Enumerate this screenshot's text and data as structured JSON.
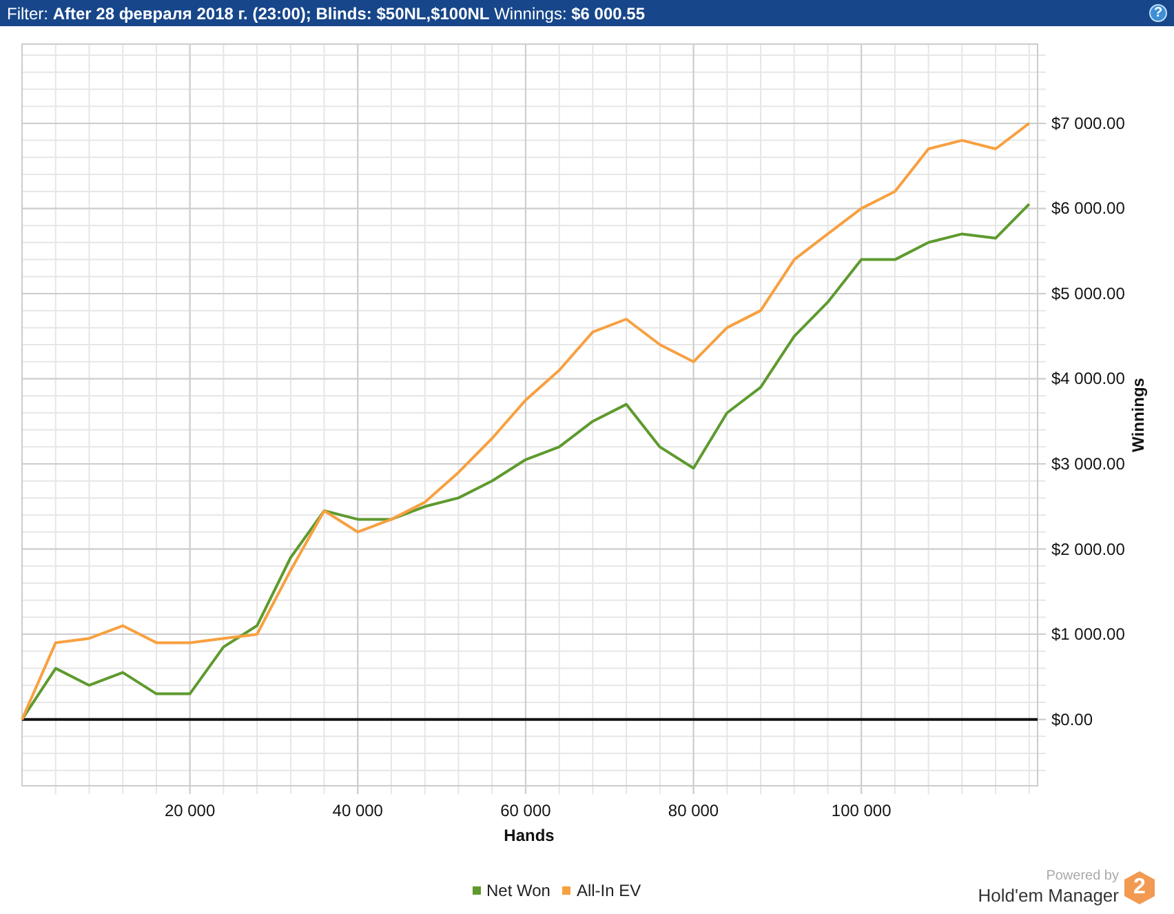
{
  "filter_bar": {
    "text": "Filter: **After 28 февраля 2018 г. (23:00); Blinds: $50NL,$100NL** Winnings: **$6 000.55**",
    "help": "?"
  },
  "chart": {
    "chart_data": {
      "type": "line",
      "grid": true,
      "xlabel": "Hands",
      "ylabel": "Winnings",
      "x": [
        0,
        4000,
        8000,
        12000,
        16000,
        20000,
        24000,
        28000,
        32000,
        36000,
        40000,
        44000,
        48000,
        52000,
        56000,
        60000,
        64000,
        68000,
        72000,
        76000,
        80000,
        84000,
        88000,
        92000,
        96000,
        100000,
        104000,
        108000,
        112000,
        116000,
        120000
      ],
      "series": [
        {
          "name": "Net Won",
          "color": "#5e9a2e",
          "values": [
            0,
            600,
            400,
            550,
            300,
            300,
            850,
            1100,
            1900,
            2450,
            2350,
            2350,
            2500,
            2600,
            2800,
            3050,
            3200,
            3500,
            3700,
            3200,
            2950,
            3600,
            3900,
            4500,
            4900,
            5400,
            5400,
            5600,
            5700,
            5650,
            6050
          ]
        },
        {
          "name": "All-In EV",
          "color": "#f7a040",
          "values": [
            0,
            900,
            950,
            1100,
            900,
            900,
            950,
            1000,
            1750,
            2450,
            2200,
            2350,
            2550,
            2900,
            3300,
            3750,
            4100,
            4550,
            4700,
            4400,
            4200,
            4600,
            4800,
            5400,
            5700,
            6000,
            6200,
            6700,
            6800,
            6700,
            7000
          ]
        }
      ],
      "xlim": [
        0,
        121000
      ],
      "ylim": [
        -780,
        7930
      ],
      "xticks": [
        {
          "value": 20000,
          "label": "20 000"
        },
        {
          "value": 40000,
          "label": "40 000"
        },
        {
          "value": 60000,
          "label": "60 000"
        },
        {
          "value": 80000,
          "label": "80 000"
        },
        {
          "value": 100000,
          "label": "100 000"
        }
      ],
      "yticks": [
        {
          "value": 0,
          "label": "$0.00"
        },
        {
          "value": 1000,
          "label": "$1 000.00"
        },
        {
          "value": 2000,
          "label": "$2 000.00"
        },
        {
          "value": 3000,
          "label": "$3 000.00"
        },
        {
          "value": 4000,
          "label": "$4 000.00"
        },
        {
          "value": 5000,
          "label": "$5 000.00"
        },
        {
          "value": 6000,
          "label": "$6 000.00"
        },
        {
          "value": 7000,
          "label": "$7 000.00"
        }
      ]
    }
  },
  "branding": {
    "powered_by": "Powered by",
    "product": "Hold'em Manager",
    "badge": "2"
  }
}
